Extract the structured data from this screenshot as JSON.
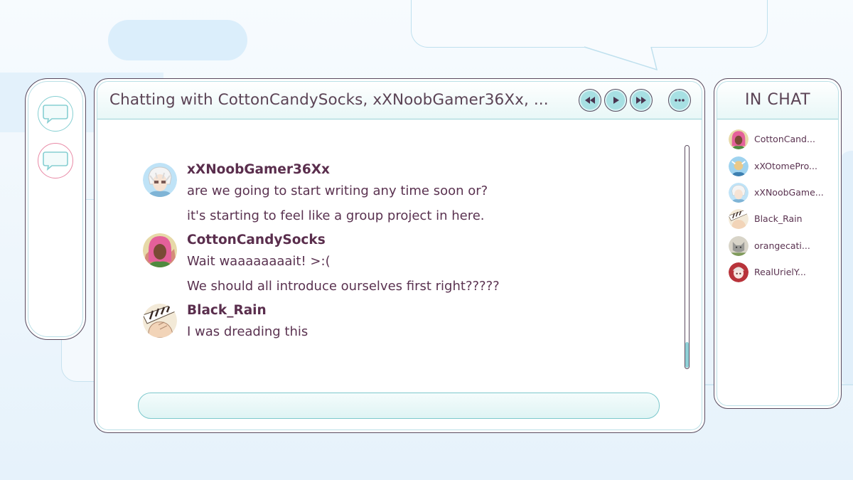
{
  "chat": {
    "title": "Chatting with CottonCandySocks, xXNoobGamer36Xx, ...",
    "input_placeholder": ""
  },
  "sidebar": {
    "buttons": [
      {
        "icon": "chat-bubble-icon",
        "color": "#86cfd2"
      },
      {
        "icon": "chat-bubble-icon",
        "color": "#e98aa6"
      }
    ]
  },
  "controls": {
    "rewind_icon": "rewind-icon",
    "play_icon": "play-icon",
    "fast_forward_icon": "fast-forward-icon",
    "more_icon": "more-icon"
  },
  "messages": [
    {
      "user": "xXNoobGamer36Xx",
      "lines": [
        "are we going to start writing any time soon or?",
        "it's starting to feel like a group project in here."
      ]
    },
    {
      "user": "CottonCandySocks",
      "lines": [
        "Wait waaaaaaaait! >:(",
        "We should all introduce ourselves first right?????"
      ]
    },
    {
      "user": "Black_Rain",
      "lines": [
        "I was dreading this"
      ]
    }
  ],
  "in_chat": {
    "title": "IN CHAT",
    "members": [
      {
        "name": "CottonCand..."
      },
      {
        "name": "xXOtomePro..."
      },
      {
        "name": "xXNoobGame..."
      },
      {
        "name": "Black_Rain"
      },
      {
        "name": "orangecati..."
      },
      {
        "name": "RealUrielY..."
      }
    ]
  },
  "colors": {
    "accent": "#a7e0e3",
    "text": "#5a3250",
    "border": "#5a4a5e"
  }
}
